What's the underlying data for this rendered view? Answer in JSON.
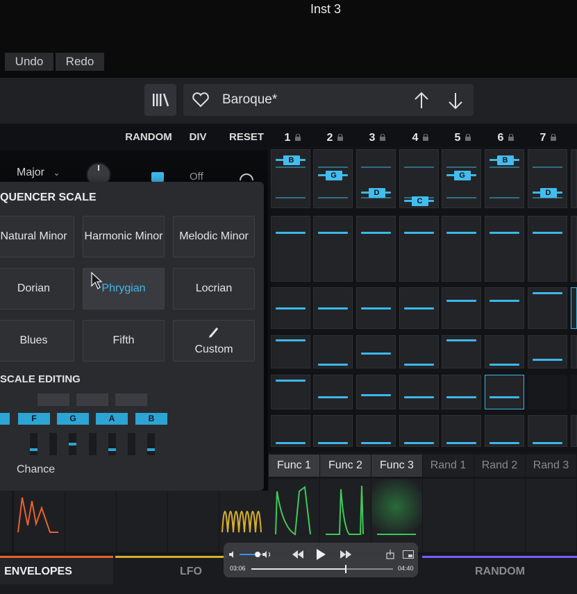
{
  "window": {
    "title": "Inst 3"
  },
  "toolbar": {
    "undo_label": "Undo",
    "redo_label": "Redo"
  },
  "preset": {
    "name": "Baroque*"
  },
  "sequencer": {
    "random_label": "RANDOM",
    "div_label": "DIV",
    "reset_label": "RESET",
    "steps": [
      "1",
      "2",
      "3",
      "4",
      "5",
      "6",
      "7"
    ],
    "key_label": "Major",
    "div_value": "Off"
  },
  "scale_popup": {
    "title": "QUENCER SCALE",
    "scales": [
      "Natural Minor",
      "Harmonic Minor",
      "Melodic Minor",
      "Dorian",
      "Phrygian",
      "Locrian",
      "Blues",
      "Fifth",
      "Custom"
    ],
    "selected": "Phrygian",
    "editing_title": "SCALE EDITING",
    "notes": [
      "F",
      "G",
      "A",
      "B"
    ],
    "chance_label": "Chance"
  },
  "mod_tabs": [
    "Func 1",
    "Func 2",
    "Func 3",
    "Rand 1",
    "Rand 2",
    "Rand 3"
  ],
  "bottom_tabs": {
    "envelopes": "ENVELOPES",
    "lfo": "LFO",
    "random": "RANDOM"
  },
  "player": {
    "elapsed": "03:06",
    "total": "04:40",
    "progress": 0.66
  },
  "note_labels": [
    "B",
    "G",
    "D",
    "C",
    "G",
    "B",
    "D"
  ],
  "colors": {
    "accent": "#3cb8ea",
    "envelope": "#e8622e",
    "lfo": "#d8b02a",
    "func": "#3ccb5a",
    "random": "#7a5cff"
  }
}
